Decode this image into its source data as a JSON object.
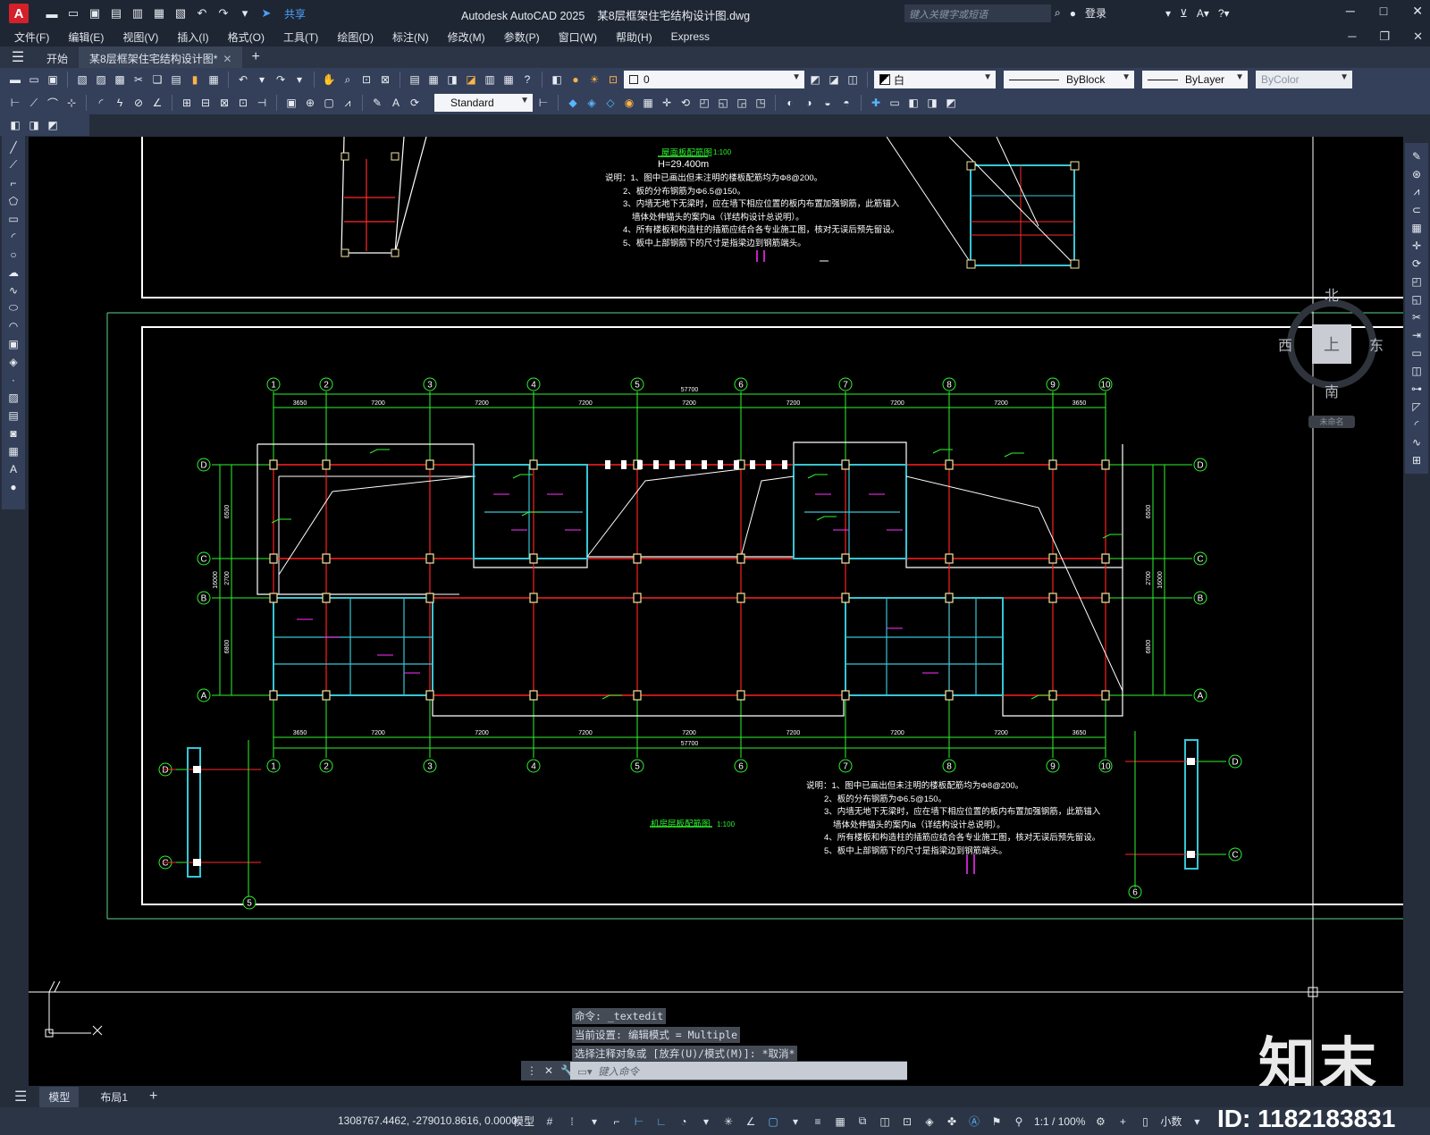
{
  "app": {
    "title": "Autodesk AutoCAD 2025",
    "filename": "某8层框架住宅结构设计图.dwg",
    "search_placeholder": "键入关键字或短语",
    "login": "登录",
    "share": "共享"
  },
  "menu": [
    "文件(F)",
    "编辑(E)",
    "视图(V)",
    "插入(I)",
    "格式(O)",
    "工具(T)",
    "绘图(D)",
    "标注(N)",
    "修改(M)",
    "参数(P)",
    "窗口(W)",
    "帮助(H)",
    "Express"
  ],
  "tabs": {
    "start": "开始",
    "doc": "某8层框架住宅结构设计图*"
  },
  "toolbar": {
    "layer_value": "0",
    "color_value": "白",
    "linetype_value": "ByBlock",
    "lineweight_value": "ByLayer",
    "plotstyle_value": "ByColor",
    "dimstyle_value": "Standard"
  },
  "drawing": {
    "upper_title": "屋面板配筋图",
    "upper_scale": "1:100",
    "upper_elev": "H=29.400m",
    "notes": [
      "说明：1、图中已画出但未注明的楼板配筋均为Φ8@200。",
      "2、板的分布钢筋为Φ6.5@150。",
      "3、内墙无地下无梁时，应在墙下相应位置的板内布置加强钢筋，此筋锚入",
      "墙体处伸锚头的案内la（详结构设计总说明）。",
      "4、所有楼板和构造柱的插筋应结合各专业施工图，核对无误后预先留设。",
      "5、板中上部钢筋下的尺寸是指梁边到钢筋端头。"
    ],
    "lower_title": "机房层板配筋图",
    "lower_scale": "1:100",
    "grid_numbers": [
      "1",
      "2",
      "3",
      "4",
      "5",
      "6",
      "7",
      "8",
      "9",
      "10"
    ],
    "grid_letters_left": [
      "D",
      "C",
      "B",
      "A"
    ],
    "dims_top": [
      "3650",
      "7200",
      "7200",
      "7200",
      "7200",
      "7200",
      "7200",
      "7200",
      "3650"
    ],
    "total_dim": "57700",
    "dims_side_left": [
      "6500",
      "2700",
      "6800"
    ],
    "side_total": "16000",
    "section_left_axis": "5",
    "section_right_axis": "6"
  },
  "viewcube": {
    "north": "北",
    "south": "南",
    "east": "东",
    "west": "西",
    "top": "上",
    "wcs": "未命名"
  },
  "command": {
    "history": [
      "命令: _textedit",
      "当前设置: 编辑模式 = Multiple",
      "选择注释对象或 [放弃(U)/模式(M)]: *取消*"
    ],
    "placeholder": "键入命令"
  },
  "layouts": [
    "模型",
    "布局1"
  ],
  "status": {
    "coords": "1308767.4462, -279010.8616, 0.0000",
    "model": "模型",
    "scale": "1:1 / 100%",
    "units": "小数"
  },
  "watermark": {
    "brand": "知末",
    "id": "ID: 1182183831"
  },
  "colors": {
    "accent": "#4aa3ff",
    "logo": "#d3202a",
    "grid_green": "#2ef32e",
    "beam_red": "#ff2020",
    "column_cyan": "#36c6d6"
  }
}
